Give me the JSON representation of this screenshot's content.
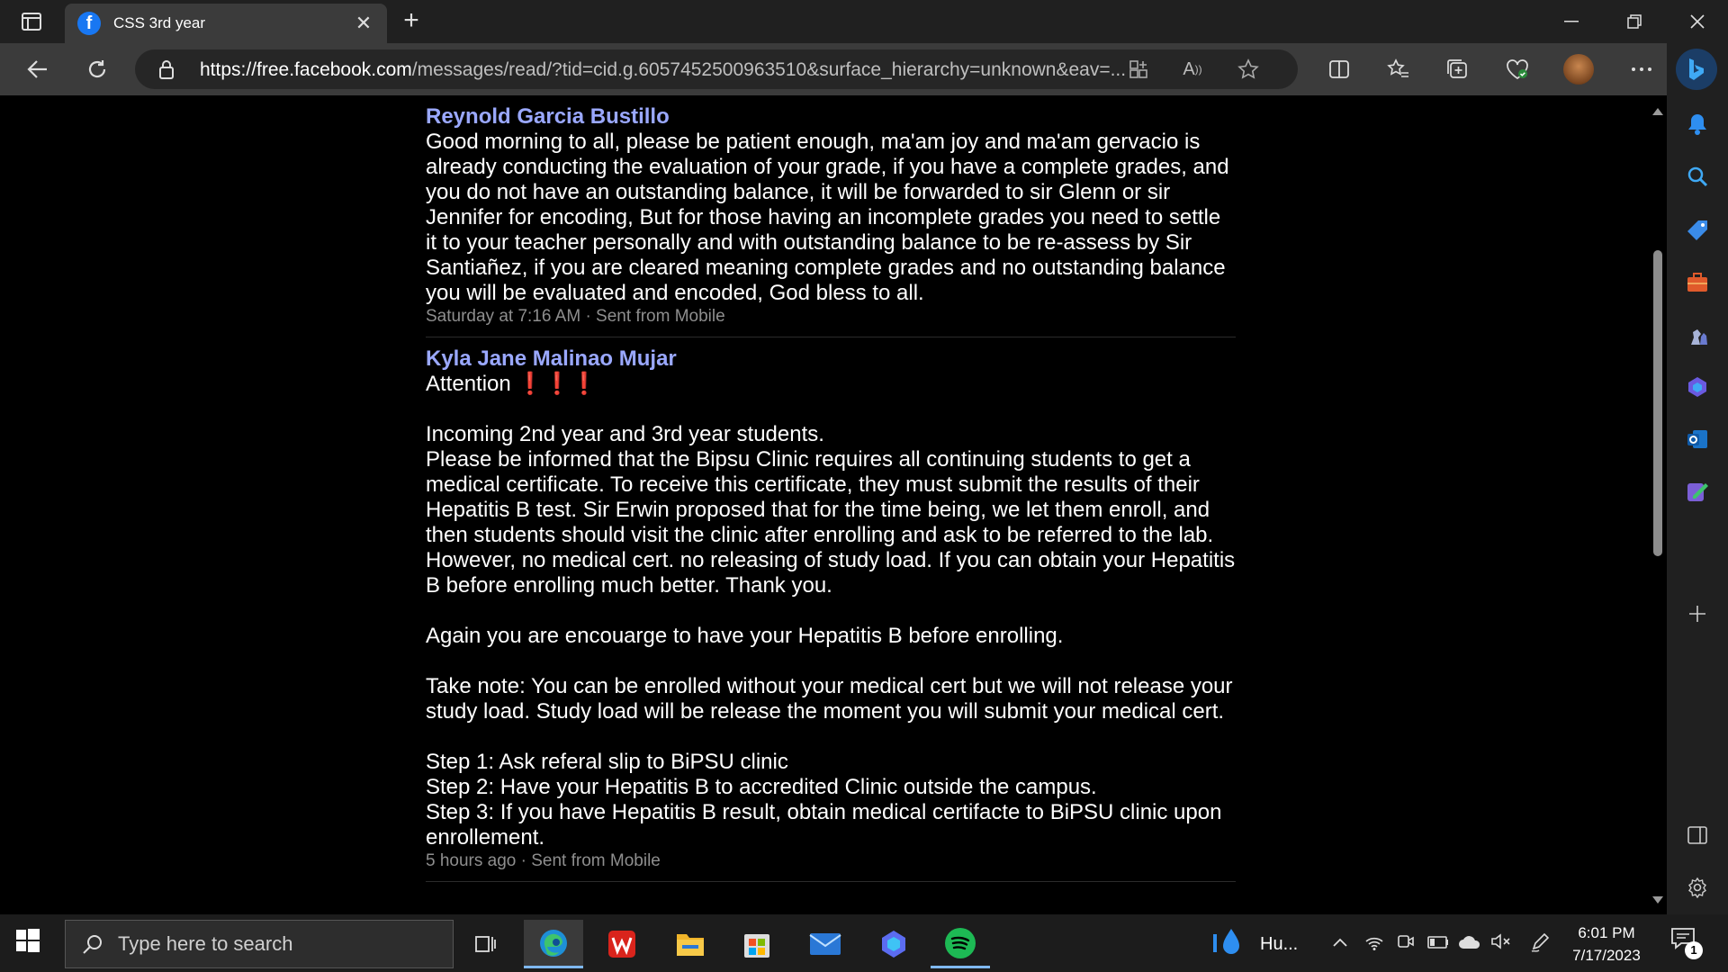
{
  "browser": {
    "tab_title": "CSS 3rd year",
    "tab_favicon": "f",
    "url_host": "https://free.facebook.com",
    "url_path": "/messages/read/?tid=cid.g.6057452500963510&surface_hierarchy=unknown&eav=..."
  },
  "messages": [
    {
      "sender": "Reynold Garcia Bustillo",
      "body": "Good morning to all, please be patient enough, ma'am joy and ma'am gervacio is already conducting the evaluation of your grade, if you have a complete grades, and you do not have an outstanding balance, it will be forwarded to sir Glenn or sir Jennifer for encoding, But for those having an incomplete grades you need to settle it to your teacher personally and with outstanding balance to be re-assess by Sir Santiañez, if you are cleared meaning complete grades and no outstanding balance you will be evaluated and encoded, God bless to all.",
      "meta": "Saturday at 7:16 AM · Sent from Mobile"
    },
    {
      "sender": "Kyla Jane Malinao Mujar",
      "body": "Attention ❗❗❗\n\nIncoming 2nd year and 3rd year students.\nPlease be informed that the Bipsu Clinic requires all continuing students to get a medical certificate. To receive this certificate, they must submit the results of their Hepatitis B test. Sir Erwin proposed that for the time being, we let them enroll, and then students should visit the clinic after enrolling and ask to be referred to the lab. However, no medical cert. no releasing of study load. If you can obtain your Hepatitis B before enrolling much better. Thank you.\n\nAgain you are encouarge to have your Hepatitis B before enrolling.\n\nTake note: You can be enrolled without your medical cert but we will not release your study load. Study load will be release the moment you will submit your medical cert.\n\nStep 1: Ask referal slip to BiPSU clinic\nStep 2: Have your Hepatitis B to accredited Clinic outside the campus.\nStep 3: If you have Hepatitis B result, obtain medical certifacte to BiPSU clinic upon enrollement.",
      "meta": "5 hours ago · Sent from Mobile"
    }
  ],
  "taskbar": {
    "search_placeholder": "Type here to search",
    "weather_text": "Hu...",
    "time": "6:01 PM",
    "date": "7/17/2023",
    "notification_count": "1"
  },
  "colors": {
    "sender_link": "#9aa8ff",
    "facebook_blue": "#1877f2",
    "spotify_green": "#1db954"
  }
}
